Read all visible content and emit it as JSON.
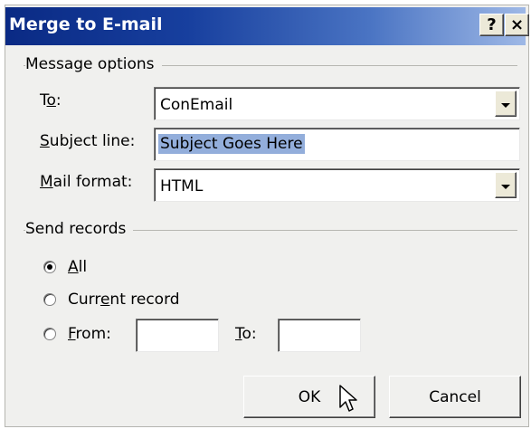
{
  "window": {
    "title": "Merge to E-mail",
    "help_glyph": "?",
    "close_glyph": "×"
  },
  "message_options": {
    "group_label": "Message options",
    "to": {
      "label": "To:",
      "value": "ConEmail"
    },
    "subject": {
      "label": "Subject line:",
      "value": "Subject Goes Here"
    },
    "mail_format": {
      "label": "Mail format:",
      "value": "HTML"
    }
  },
  "send_records": {
    "group_label": "Send records",
    "options": [
      {
        "label": "All",
        "checked": true
      },
      {
        "label": "Current record",
        "checked": false
      },
      {
        "label": "From:",
        "checked": false
      }
    ],
    "to_label": "To:",
    "from_value": "",
    "to_value": ""
  },
  "buttons": {
    "ok": "OK",
    "cancel": "Cancel"
  },
  "colors": {
    "title_bar_start": "#0a2a84",
    "title_bar_end": "#9eb8e6",
    "selection": "#93aedb",
    "dialog_bg": "#f0f0ee"
  },
  "icons": [
    "help-icon",
    "close-icon",
    "dropdown-arrow-icon",
    "mouse-pointer-icon"
  ]
}
